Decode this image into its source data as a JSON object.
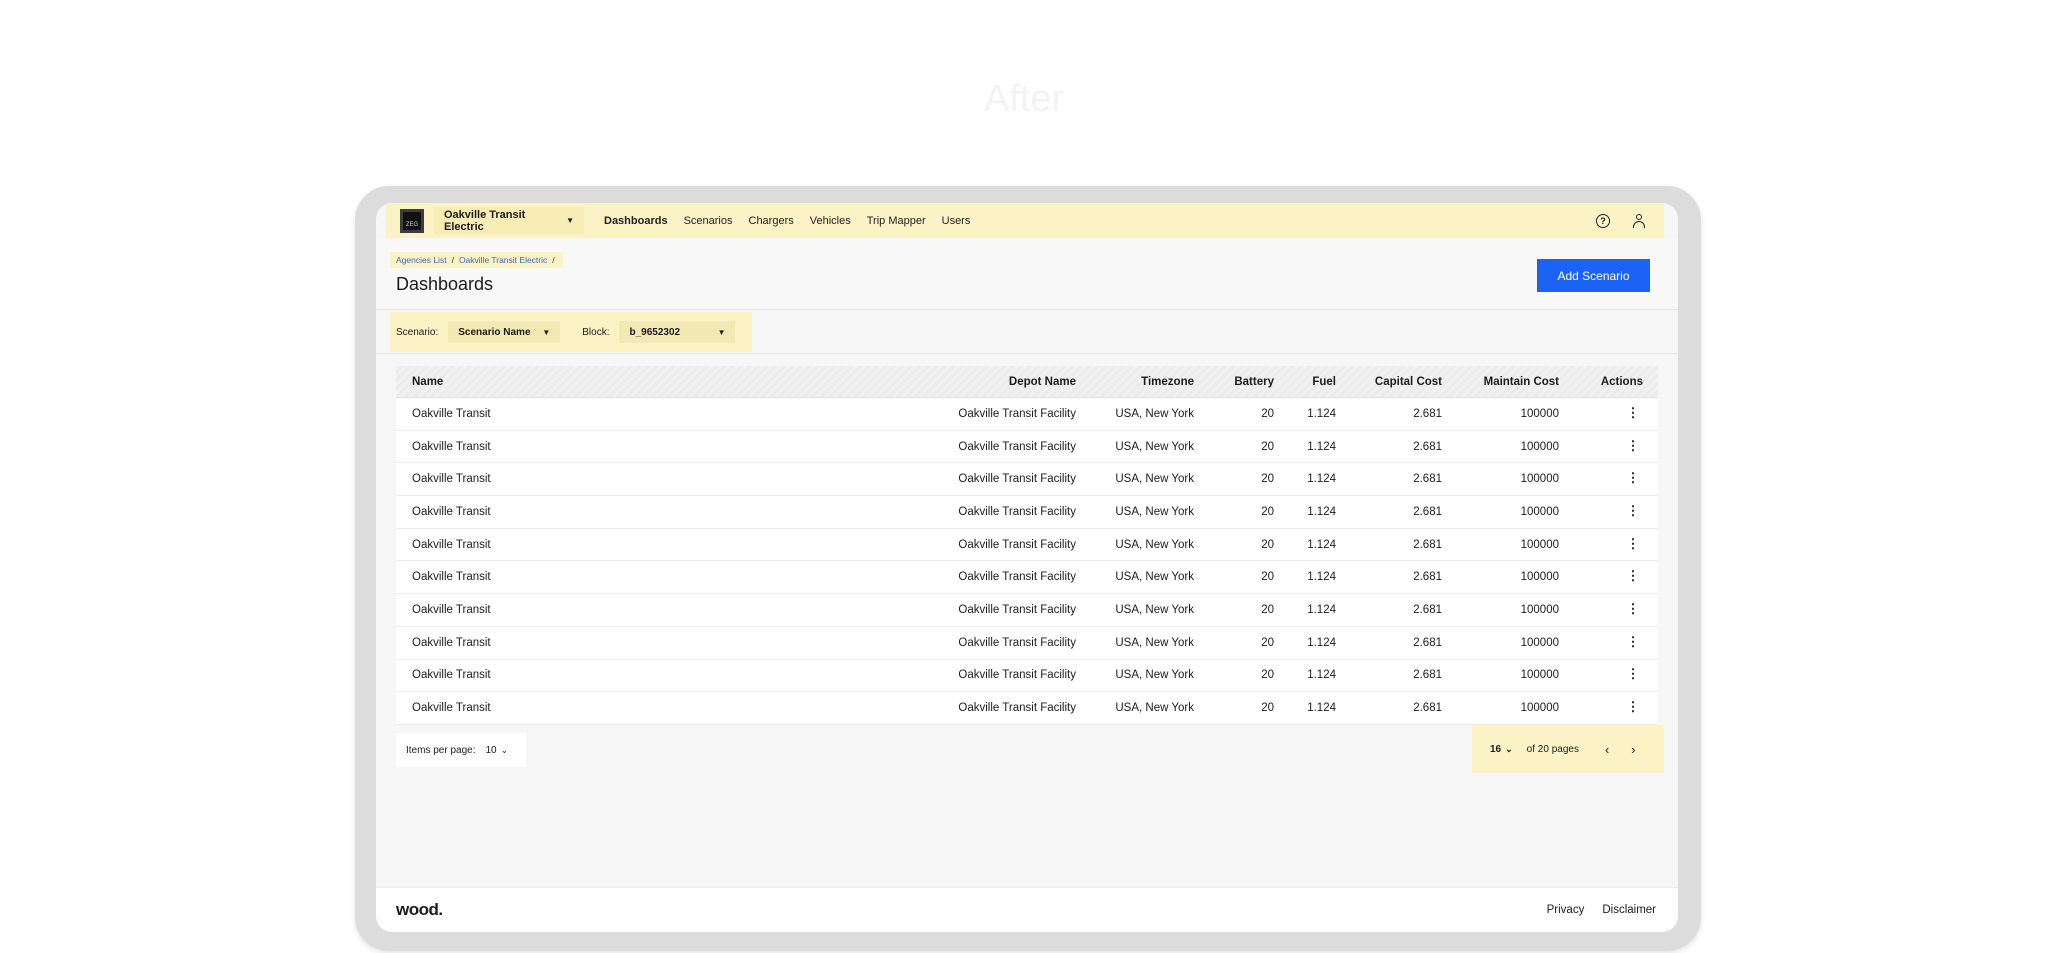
{
  "watermark": "After",
  "topbar": {
    "logo_text": "ZEG",
    "agency": "Oakville Transit Electric",
    "nav": [
      "Dashboards",
      "Scenarios",
      "Chargers",
      "Vehicles",
      "Trip Mapper",
      "Users"
    ],
    "active_nav": "Dashboards",
    "help_icon": "question-circle-icon",
    "user_icon": "user-icon"
  },
  "breadcrumb": {
    "items": [
      "Agencies List",
      "Oakville Transit Electric"
    ],
    "separator": "/"
  },
  "page": {
    "title": "Dashboards",
    "add_button": "Add Scenario"
  },
  "filters": {
    "scenario_label": "Scenario:",
    "scenario_value": "Scenario Name",
    "block_label": "Block:",
    "block_value": "b_9652302"
  },
  "table": {
    "headers": [
      "Name",
      "Depot Name",
      "Timezone",
      "Battery",
      "Fuel",
      "Capital Cost",
      "Maintain Cost",
      "Actions"
    ],
    "rows": [
      [
        "Oakville Transit",
        "Oakville Transit Facility",
        "USA, New York",
        "20",
        "1.124",
        "2.681",
        "100000"
      ],
      [
        "Oakville Transit",
        "Oakville Transit Facility",
        "USA, New York",
        "20",
        "1.124",
        "2.681",
        "100000"
      ],
      [
        "Oakville Transit",
        "Oakville Transit Facility",
        "USA, New York",
        "20",
        "1.124",
        "2.681",
        "100000"
      ],
      [
        "Oakville Transit",
        "Oakville Transit Facility",
        "USA, New York",
        "20",
        "1.124",
        "2.681",
        "100000"
      ],
      [
        "Oakville Transit",
        "Oakville Transit Facility",
        "USA, New York",
        "20",
        "1.124",
        "2.681",
        "100000"
      ],
      [
        "Oakville Transit",
        "Oakville Transit Facility",
        "USA, New York",
        "20",
        "1.124",
        "2.681",
        "100000"
      ],
      [
        "Oakville Transit",
        "Oakville Transit Facility",
        "USA, New York",
        "20",
        "1.124",
        "2.681",
        "100000"
      ],
      [
        "Oakville Transit",
        "Oakville Transit Facility",
        "USA, New York",
        "20",
        "1.124",
        "2.681",
        "100000"
      ],
      [
        "Oakville Transit",
        "Oakville Transit Facility",
        "USA, New York",
        "20",
        "1.124",
        "2.681",
        "100000"
      ],
      [
        "Oakville Transit",
        "Oakville Transit Facility",
        "USA, New York",
        "20",
        "1.124",
        "2.681",
        "100000"
      ]
    ]
  },
  "pagination": {
    "items_per_page_label": "Items per page:",
    "items_per_page": "10",
    "current_page": "16",
    "of_pages": "of 20 pages",
    "prev_icon": "chevron-left-icon",
    "next_icon": "chevron-right-icon"
  },
  "footer": {
    "brand": "wood.",
    "links": [
      "Privacy",
      "Disclaimer"
    ]
  },
  "colors": {
    "highlight": "#fbf3c6",
    "primary": "#1b63f5",
    "link": "#3a6ab8"
  }
}
